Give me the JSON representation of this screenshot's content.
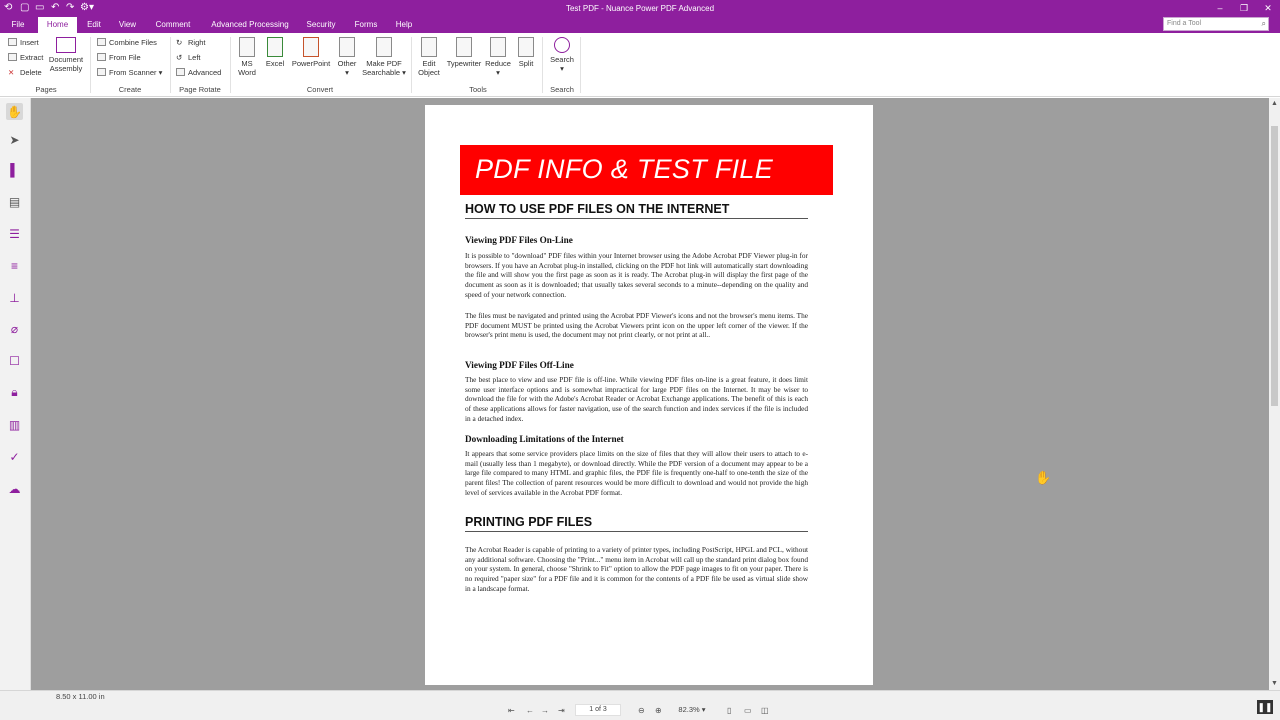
{
  "window": {
    "title": "Test PDF - Nuance Power PDF Advanced",
    "minimize": "–",
    "maximize": "❐",
    "close": "✕"
  },
  "quick_access": [
    "⟲",
    "▢",
    "▭",
    "↶",
    "↷",
    "⚙▾"
  ],
  "menu": {
    "tabs": [
      "File",
      "Home",
      "Edit",
      "View",
      "Comment",
      "Advanced Processing",
      "Security",
      "Forms",
      "Help"
    ],
    "active": "Home",
    "find_tool_placeholder": "Find a Tool"
  },
  "ribbon": {
    "pages": {
      "insert": "Insert",
      "extract": "Extract",
      "delete": "Delete",
      "doc_assembly_1": "Document",
      "doc_assembly_2": "Assembly",
      "label": "Pages"
    },
    "create": {
      "combine": "Combine Files",
      "from_file": "From File",
      "from_scanner": "From Scanner ▾",
      "label": "Create"
    },
    "rotate": {
      "right": "Right",
      "left": "Left",
      "advanced": "Advanced",
      "label": "Page Rotate"
    },
    "convert": {
      "ms_word_1": "MS",
      "ms_word_2": "Word",
      "excel": "Excel",
      "powerpoint": "PowerPoint",
      "other_1": "Other",
      "other_2": "▾",
      "make_pdf_1": "Make PDF",
      "make_pdf_2": "Searchable ▾",
      "label": "Convert"
    },
    "tools": {
      "edit_object_1": "Edit",
      "edit_object_2": "Object",
      "typewriter": "Typewriter",
      "reduce_1": "Reduce",
      "reduce_2": "▾",
      "split": "Split",
      "label": "Tools"
    },
    "search": {
      "search_1": "Search",
      "search_2": "▾",
      "label": "Search"
    }
  },
  "document": {
    "banner": "PDF INFO & TEST FILE",
    "heading1": "HOW TO USE PDF FILES ON THE INTERNET",
    "sec1_title": "Viewing PDF Files On-Line",
    "sec1_p1": "It is possible to \"download\" PDF files within your Internet browser using the Adobe Acrobat PDF Viewer plug-in for browsers. If you have an Acrobat plug-in installed, clicking on the PDF hot link will automatically start downloading the file and will show you the first page as soon as it is ready. The Acrobat plug-in will display the first page of the document as soon as it is downloaded; that usually takes several seconds to a minute--depending on the quality and speed of your network connection.",
    "sec1_p2": "The files must be navigated and printed using the Acrobat PDF Viewer's icons and not the browser's menu items. The PDF document MUST be printed using the Acrobat Viewers print icon on the upper left corner of the viewer. If the browser's print menu is used, the document may not print clearly, or not print at all..",
    "sec2_title": "Viewing PDF Files Off-Line",
    "sec2_p1": "The best place to view and use PDF file is off-line. While viewing PDF files on-line is a great feature, it does limit some user interface options and is somewhat impractical for large PDF files on the Internet. It may be wiser to download the file for with the Adobe's Acrobat Reader or Acrobat Exchange applications. The benefit of this is each of these applications allows for faster navigation, use of the search function and index services if the file is included in a detached index.",
    "sec3_title": "Downloading Limitations of the Internet",
    "sec3_p1": "It appears that some service providers place limits on the size of files that they will allow their users to attach to e-mail (usually less than 1 megabyte), or download directly. While the PDF version of a document may appear to be a large file compared to many HTML and graphic files, the PDF file is frequently one-half to one-tenth the size of the parent files! The collection of parent resources would be more difficult to download and would not provide the high level of services available in the Acrobat PDF format.",
    "heading2": "PRINTING PDF FILES",
    "sec4_p1": "The Acrobat Reader is capable of printing to a variety of printer types, including PostScript, HPGL and PCL, without any additional software. Choosing the \"Print...\" menu item in Acrobat will call up the standard print dialog box found on your system. In general, choose \"Shrink to Fit\" option to allow the PDF page images to fit on your paper. There is no required \"paper size\" for a PDF file and it is common for the contents of a PDF file be used as virtual slide show in a landscape format."
  },
  "status": {
    "page_size": "8.50 x 11.00 in",
    "page_indicator": "1 of 3",
    "zoom": "82.3%",
    "zoom_arrow": "▾"
  },
  "colors": {
    "accent": "#8e1f9e",
    "banner": "#ff0000",
    "workspace": "#9e9e9e"
  }
}
